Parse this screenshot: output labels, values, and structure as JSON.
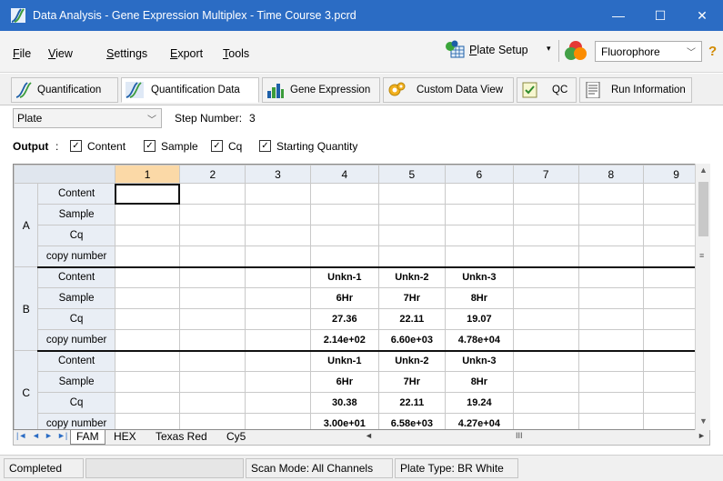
{
  "window": {
    "title": "Data Analysis - Gene Expression Multiplex - Time Course 3.pcrd",
    "minimize": "—",
    "maximize": "☐",
    "close": "✕",
    "title_bar_color": "#2b6cc4"
  },
  "menu": {
    "items": [
      {
        "key": "F",
        "rest": "ile"
      },
      {
        "key": "V",
        "rest": "iew"
      },
      {
        "key": "S",
        "rest": "ettings"
      },
      {
        "key": "E",
        "rest": "xport"
      },
      {
        "key": "T",
        "rest": "ools"
      }
    ],
    "plate_setup": {
      "key": "P",
      "rest": "late Setup",
      "arrow": "▾"
    },
    "fluorophore": "Fluorophore",
    "help": "?"
  },
  "tabs": [
    {
      "label": "Quantification",
      "icon": "amplification-curve-icon"
    },
    {
      "label": "Quantification Data",
      "icon": "quantification-data-icon",
      "active": true
    },
    {
      "label": "Gene Expression",
      "icon": "bar-chart-icon"
    },
    {
      "label": "Custom Data View",
      "icon": "custom-view-gear-icon"
    },
    {
      "label": "QC",
      "icon": "qc-check-icon"
    },
    {
      "label": "Run Information",
      "icon": "document-icon"
    }
  ],
  "plate_view": {
    "selected": "Plate",
    "step_label": "Step Number:",
    "step_value": "3"
  },
  "output": {
    "label": "Output",
    "colon": ":",
    "options": [
      {
        "label": "Content",
        "checked": true
      },
      {
        "label": "Sample",
        "checked": true
      },
      {
        "label": "Cq",
        "checked": true
      },
      {
        "label": "Starting Quantity",
        "checked": true
      }
    ],
    "check_mark": "✓"
  },
  "grid": {
    "columns": [
      "1",
      "2",
      "3",
      "4",
      "5",
      "6",
      "7",
      "8",
      "9"
    ],
    "selected_column": "1",
    "row_labels": [
      "Content",
      "Sample",
      "Cq",
      "copy number"
    ],
    "rows": [
      {
        "group": "A",
        "cells": [
          [
            "",
            "",
            "",
            "",
            "",
            "",
            "",
            "",
            ""
          ],
          [
            "",
            "",
            "",
            "",
            "",
            "",
            "",
            "",
            ""
          ],
          [
            "",
            "",
            "",
            "",
            "",
            "",
            "",
            "",
            ""
          ],
          [
            "",
            "",
            "",
            "",
            "",
            "",
            "",
            "",
            ""
          ]
        ]
      },
      {
        "group": "B",
        "cells": [
          [
            "",
            "",
            "",
            "Unkn-1",
            "Unkn-2",
            "Unkn-3",
            "",
            "",
            ""
          ],
          [
            "",
            "",
            "",
            "6Hr",
            "7Hr",
            "8Hr",
            "",
            "",
            ""
          ],
          [
            "",
            "",
            "",
            "27.36",
            "22.11",
            "19.07",
            "",
            "",
            ""
          ],
          [
            "",
            "",
            "",
            "2.14e+02",
            "6.60e+03",
            "4.78e+04",
            "",
            "",
            ""
          ]
        ]
      },
      {
        "group": "C",
        "cells": [
          [
            "",
            "",
            "",
            "Unkn-1",
            "Unkn-2",
            "Unkn-3",
            "",
            "",
            ""
          ],
          [
            "",
            "",
            "",
            "6Hr",
            "7Hr",
            "8Hr",
            "",
            "",
            ""
          ],
          [
            "",
            "",
            "",
            "30.38",
            "22.11",
            "19.24",
            "",
            "",
            ""
          ],
          [
            "",
            "",
            "",
            "3.00e+01",
            "6.58e+03",
            "4.27e+04",
            "",
            "",
            ""
          ]
        ]
      }
    ]
  },
  "sheets": {
    "tabs": [
      "FAM",
      "HEX",
      "Texas Red",
      "Cy5"
    ],
    "active": "FAM",
    "nav": [
      "|◄",
      "◄",
      "►",
      "►|"
    ],
    "scroll_left": "◄",
    "scroll_right": "►",
    "grip": "III"
  },
  "status": {
    "state": "Completed",
    "progress": "",
    "scan_mode": "Scan Mode: All Channels",
    "plate_type": "Plate Type: BR White"
  }
}
